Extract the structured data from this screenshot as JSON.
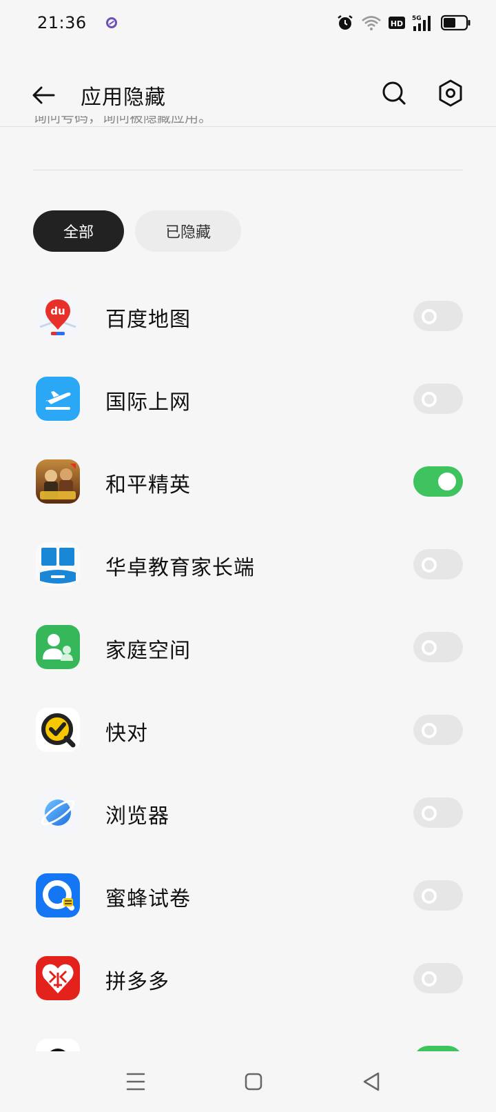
{
  "status_bar": {
    "time": "21:36",
    "icons": [
      "notification-icon",
      "alarm-icon",
      "wifi-icon",
      "hd-icon",
      "signal-5g-icon",
      "battery-icon"
    ]
  },
  "app_bar": {
    "title": "应用隐藏",
    "back_icon": "back-arrow-icon",
    "search_icon": "search-icon",
    "settings_icon": "gear-icon"
  },
  "description": "询问号码，询问被隐藏应用。",
  "tabs": [
    {
      "label": "全部",
      "active": true
    },
    {
      "label": "已隐藏",
      "active": false
    }
  ],
  "apps": [
    {
      "name": "百度地图",
      "hidden": false,
      "icon": "baidu-map-icon"
    },
    {
      "name": "国际上网",
      "hidden": false,
      "icon": "global-internet-icon"
    },
    {
      "name": "和平精英",
      "hidden": true,
      "icon": "peace-elite-icon"
    },
    {
      "name": "华卓教育家长端",
      "hidden": false,
      "icon": "huazhuo-education-icon"
    },
    {
      "name": "家庭空间",
      "hidden": false,
      "icon": "family-space-icon"
    },
    {
      "name": "快对",
      "hidden": false,
      "icon": "kuaidui-icon"
    },
    {
      "name": "浏览器",
      "hidden": false,
      "icon": "browser-icon"
    },
    {
      "name": "蜜蜂试卷",
      "hidden": false,
      "icon": "bee-exam-icon"
    },
    {
      "name": "拼多多",
      "hidden": false,
      "icon": "pinduoduo-icon"
    },
    {
      "name": "",
      "hidden": true,
      "icon": "partial-app-icon"
    }
  ],
  "colors": {
    "toggle_on": "#3ec35f",
    "toggle_off": "#e6e6e6",
    "tab_active": "#222222"
  },
  "nav_bar": {
    "icons": [
      "menu-icon",
      "home-icon",
      "back-triangle-icon"
    ]
  }
}
